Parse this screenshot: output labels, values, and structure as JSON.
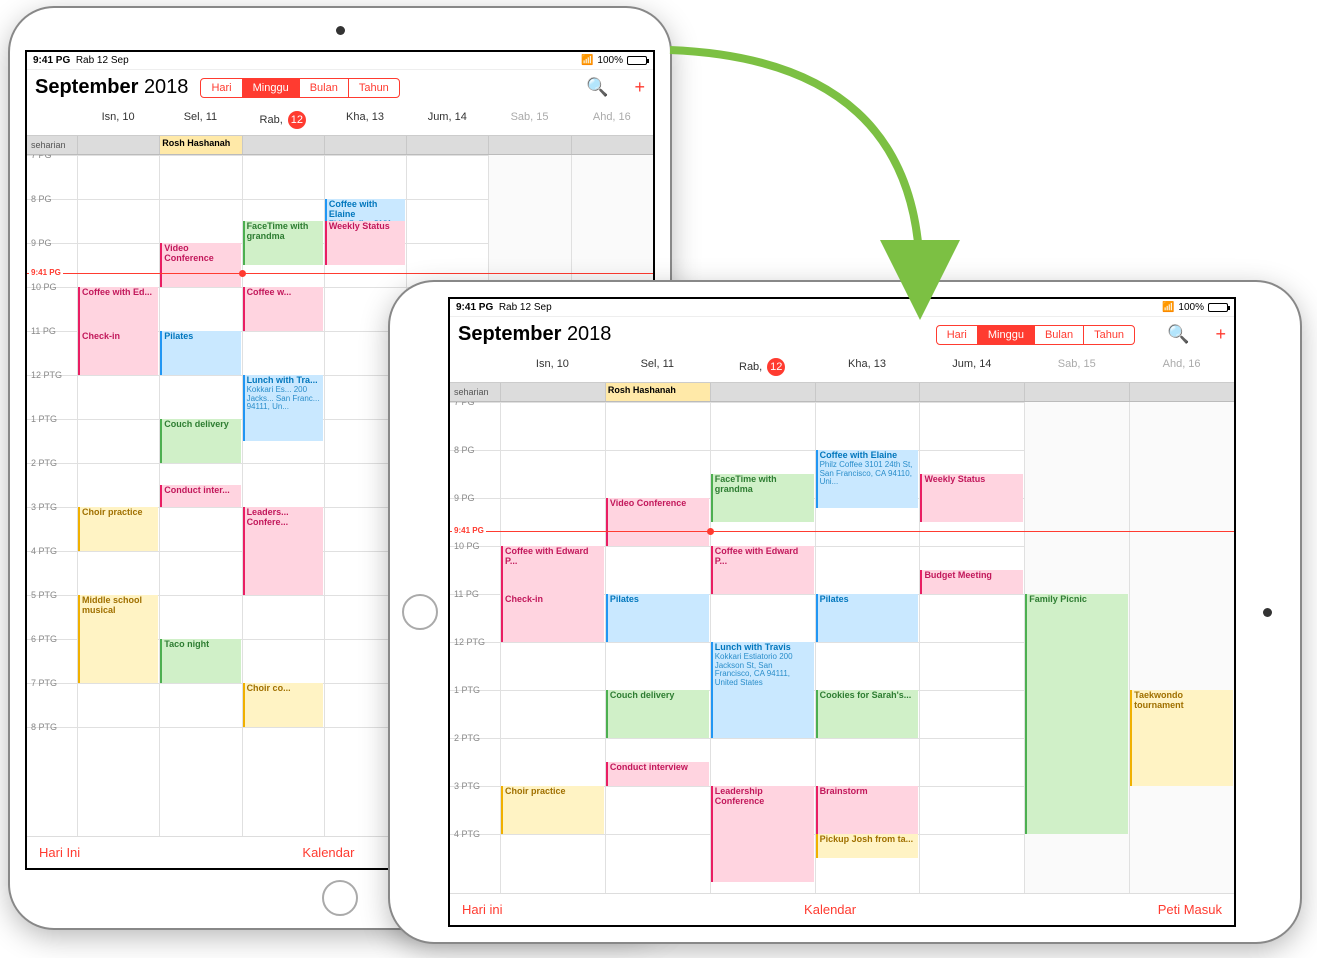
{
  "status": {
    "time": "9:41 PG",
    "date": "Rab 12 Sep",
    "wifi": "▲",
    "batt": "100%"
  },
  "header": {
    "month": "September",
    "year": "2018"
  },
  "seg": [
    "Hari",
    "Minggu",
    "Bulan",
    "Tahun"
  ],
  "days_short": [
    {
      "l": "Isn, 10"
    },
    {
      "l": "Sel, 11"
    },
    {
      "l": "Rab, ",
      "n": "12",
      "cur": true
    },
    {
      "l": "Kha, 13"
    },
    {
      "l": "Jum, 14"
    },
    {
      "l": "Sab, 15",
      "w": true
    },
    {
      "l": "Ahd, 16",
      "w": true
    }
  ],
  "allday_label": "seharian",
  "allday_event": "Rosh Hashanah",
  "hours_p": [
    "7 PG",
    "8 PG",
    "9 PG",
    "10 PG",
    "11 PG",
    "12 PTG",
    "1 PTG",
    "2 PTG",
    "3 PTG",
    "4 PTG",
    "5 PTG",
    "6 PTG",
    "7 PTG",
    "8 PTG"
  ],
  "hours_l": [
    "7 PG",
    "8 PG",
    "9 PG",
    "10 PG",
    "11 PG",
    "12 PTG",
    "1 PTG",
    "2 PTG",
    "3 PTG",
    "4 PTG"
  ],
  "now": "9:41 PG",
  "footer_p": {
    "today": "Hari Ini",
    "cal": "Kalendar",
    "inbox": "Peti Masuk"
  },
  "footer_l": {
    "today": "Hari ini",
    "cal": "Kalendar",
    "inbox": "Peti Masuk"
  },
  "events": {
    "mon": [
      {
        "t": "Coffee with Ed...",
        "s": 10,
        "d": 1,
        "c": "pk"
      },
      {
        "t": "Check-in",
        "s": 11,
        "d": 1,
        "c": "pk"
      },
      {
        "t": "Choir practice",
        "s": 15,
        "d": 1,
        "c": "yl"
      },
      {
        "t": "Middle school musical",
        "s": 17,
        "d": 2,
        "c": "yl"
      }
    ],
    "tue": [
      {
        "t": "Video Conference",
        "s": 9,
        "d": 1,
        "c": "pk"
      },
      {
        "t": "Pilates",
        "s": 11,
        "d": 1,
        "c": "bl"
      },
      {
        "t": "Couch delivery",
        "s": 13,
        "d": 1,
        "c": "gr"
      },
      {
        "t": "Conduct inter...",
        "s": 14.5,
        "d": 0.5,
        "c": "pk"
      },
      {
        "t": "Taco night",
        "s": 18,
        "d": 1,
        "c": "gr"
      }
    ],
    "wed": [
      {
        "t": "FaceTime with grandma",
        "s": 8.5,
        "d": 1,
        "c": "gr"
      },
      {
        "t": "Coffee w...",
        "s": 10,
        "d": 1,
        "c": "pk"
      },
      {
        "t": "Lunch with Tra...",
        "loc": "Kokkari Es... 200 Jacks... San Franc... 94111, Un...",
        "s": 12,
        "d": 1.5,
        "c": "bl"
      },
      {
        "t": "Leaders... Confere...",
        "s": 15,
        "d": 2,
        "c": "pk"
      },
      {
        "t": "Choir co...",
        "s": 19,
        "d": 1,
        "c": "yl"
      }
    ],
    "thu": [
      {
        "t": "Coffee with Elaine",
        "loc": "Philz Coffee 3101 24th St, San...",
        "s": 8,
        "d": 1,
        "c": "bl"
      },
      {
        "t": "Weekly Status",
        "s": 8.5,
        "d": 1,
        "c": "pk"
      }
    ],
    "sat": [],
    "sun": [
      {
        "t": "Taekwondo tournament",
        "s": 13,
        "d": 2,
        "c": "yl"
      }
    ]
  },
  "events_l": {
    "mon": [
      {
        "t": "Coffee with Edward P...",
        "s": 10,
        "d": 1,
        "c": "pk"
      },
      {
        "t": "Check-in",
        "s": 11,
        "d": 1,
        "c": "pk"
      },
      {
        "t": "Choir practice",
        "s": 15,
        "d": 1,
        "c": "yl"
      }
    ],
    "tue": [
      {
        "t": "Video Conference",
        "s": 9,
        "d": 1,
        "c": "pk"
      },
      {
        "t": "Pilates",
        "s": 11,
        "d": 1,
        "c": "bl"
      },
      {
        "t": "Couch delivery",
        "s": 13,
        "d": 1,
        "c": "gr"
      },
      {
        "t": "Conduct interview",
        "s": 14.5,
        "d": 0.5,
        "c": "pk"
      }
    ],
    "wed": [
      {
        "t": "FaceTime with grandma",
        "s": 8.5,
        "d": 1,
        "c": "gr"
      },
      {
        "t": "Coffee with Edward P...",
        "s": 10,
        "d": 1,
        "c": "pk"
      },
      {
        "t": "Lunch with Travis",
        "loc": "Kokkari Estiatorio 200 Jackson St, San Francisco, CA 94111, United States",
        "s": 12,
        "d": 2,
        "c": "bl"
      },
      {
        "t": "Leadership Conference",
        "s": 15,
        "d": 2,
        "c": "pk"
      }
    ],
    "thu": [
      {
        "t": "Coffee with Elaine",
        "loc": "Philz Coffee 3101 24th St, San Francisco, CA 94110, Uni...",
        "s": 8,
        "d": 1.2,
        "c": "bl"
      },
      {
        "t": "Pilates",
        "s": 11,
        "d": 1,
        "c": "bl"
      },
      {
        "t": "Cookies for Sarah's...",
        "s": 13,
        "d": 1,
        "c": "gr"
      },
      {
        "t": "Brainstorm",
        "s": 15,
        "d": 1,
        "c": "pk"
      },
      {
        "t": "Pickup Josh from ta...",
        "s": 16,
        "d": 0.5,
        "c": "yl"
      }
    ],
    "fri": [
      {
        "t": "Weekly Status",
        "s": 8.5,
        "d": 1,
        "c": "pk"
      },
      {
        "t": "Budget Meeting",
        "s": 10.5,
        "d": 0.5,
        "c": "pk"
      }
    ],
    "sat": [
      {
        "t": "Family Picnic",
        "s": 11,
        "d": 5,
        "c": "gr"
      }
    ],
    "sun": [
      {
        "t": "Taekwondo tournament",
        "s": 13,
        "d": 2,
        "c": "yl"
      }
    ]
  }
}
